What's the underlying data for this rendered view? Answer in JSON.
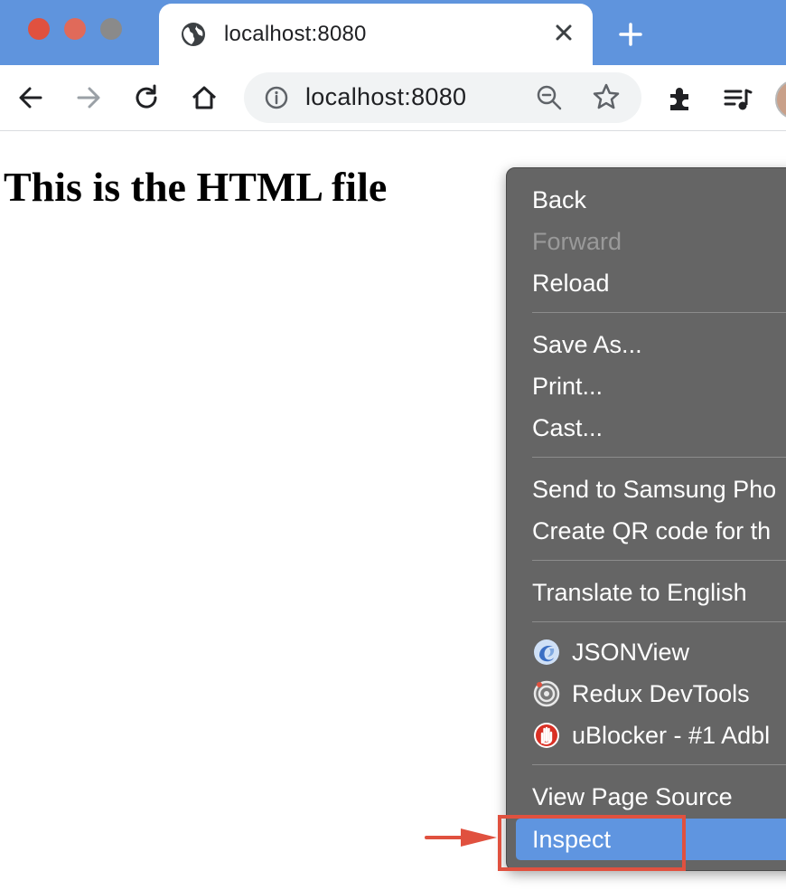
{
  "browser": {
    "tab": {
      "title": "localhost:8080",
      "favicon": "globe-icon"
    },
    "address_bar": {
      "url": "localhost:8080"
    },
    "colors": {
      "titlebar": "#5f94dd",
      "close": "#e0513f"
    }
  },
  "page": {
    "heading": "This is the HTML file"
  },
  "context_menu": {
    "items": [
      {
        "label": "Back"
      },
      {
        "label": "Forward",
        "disabled": true
      },
      {
        "label": "Reload"
      },
      {
        "label": "Save As..."
      },
      {
        "label": "Print..."
      },
      {
        "label": "Cast..."
      },
      {
        "label": "Send to Samsung Pho"
      },
      {
        "label": "Create QR code for th"
      },
      {
        "label": "Translate to English"
      },
      {
        "label": "JSONView",
        "icon": "jsonview-icon"
      },
      {
        "label": "Redux DevTools",
        "icon": "redux-devtools-icon"
      },
      {
        "label": "uBlocker - #1 Adbl",
        "icon": "ublocker-icon"
      },
      {
        "label": "View Page Source"
      },
      {
        "label": "Inspect",
        "highlighted": true
      }
    ],
    "highlight_color": "#5f95e0"
  },
  "annotation": {
    "color": "#e0513f"
  }
}
